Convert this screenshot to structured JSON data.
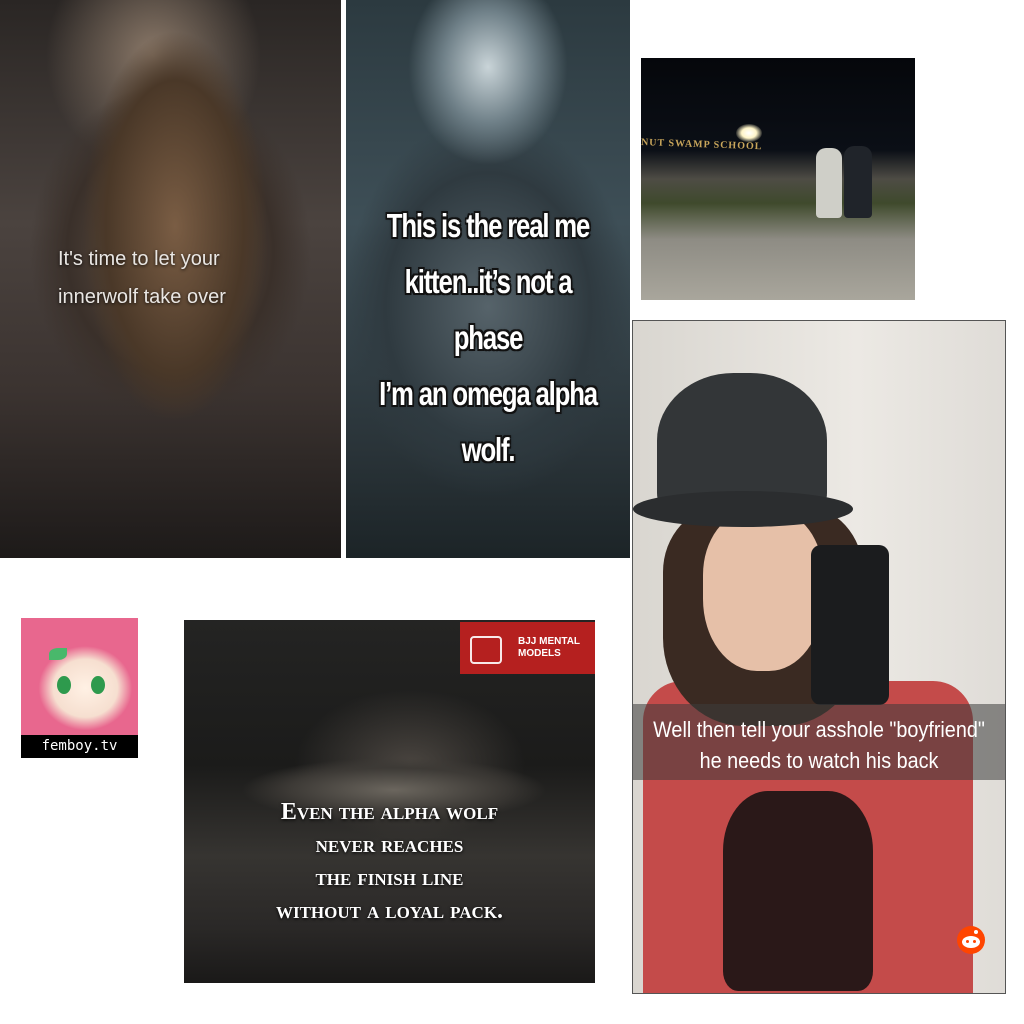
{
  "panel_innerwolf": {
    "caption_line1": "It's time to let your",
    "caption_line2": "innerwolf take over"
  },
  "panel_omega": {
    "caption_line1": "This is the real me",
    "caption_line2": "kitten..it’s not a phase",
    "caption_line3": "I’m an omega alpha wolf."
  },
  "panel_school": {
    "sign_text": "NUT SWAMP SCHOOL"
  },
  "panel_selfie": {
    "caption_line1": "Well then tell your asshole \"boyfriend\"",
    "caption_line2": "he needs to watch his back",
    "watermark_icon": "reddit-icon"
  },
  "panel_logo": {
    "label": "femboy.tv"
  },
  "panel_bjj": {
    "brand_line1": "BJJ MENTAL",
    "brand_line2": "MODELS",
    "quote_line1": "Even the alpha wolf",
    "quote_line2": "never reaches",
    "quote_line3": "the finish line",
    "quote_line4": "without a loyal pack."
  }
}
